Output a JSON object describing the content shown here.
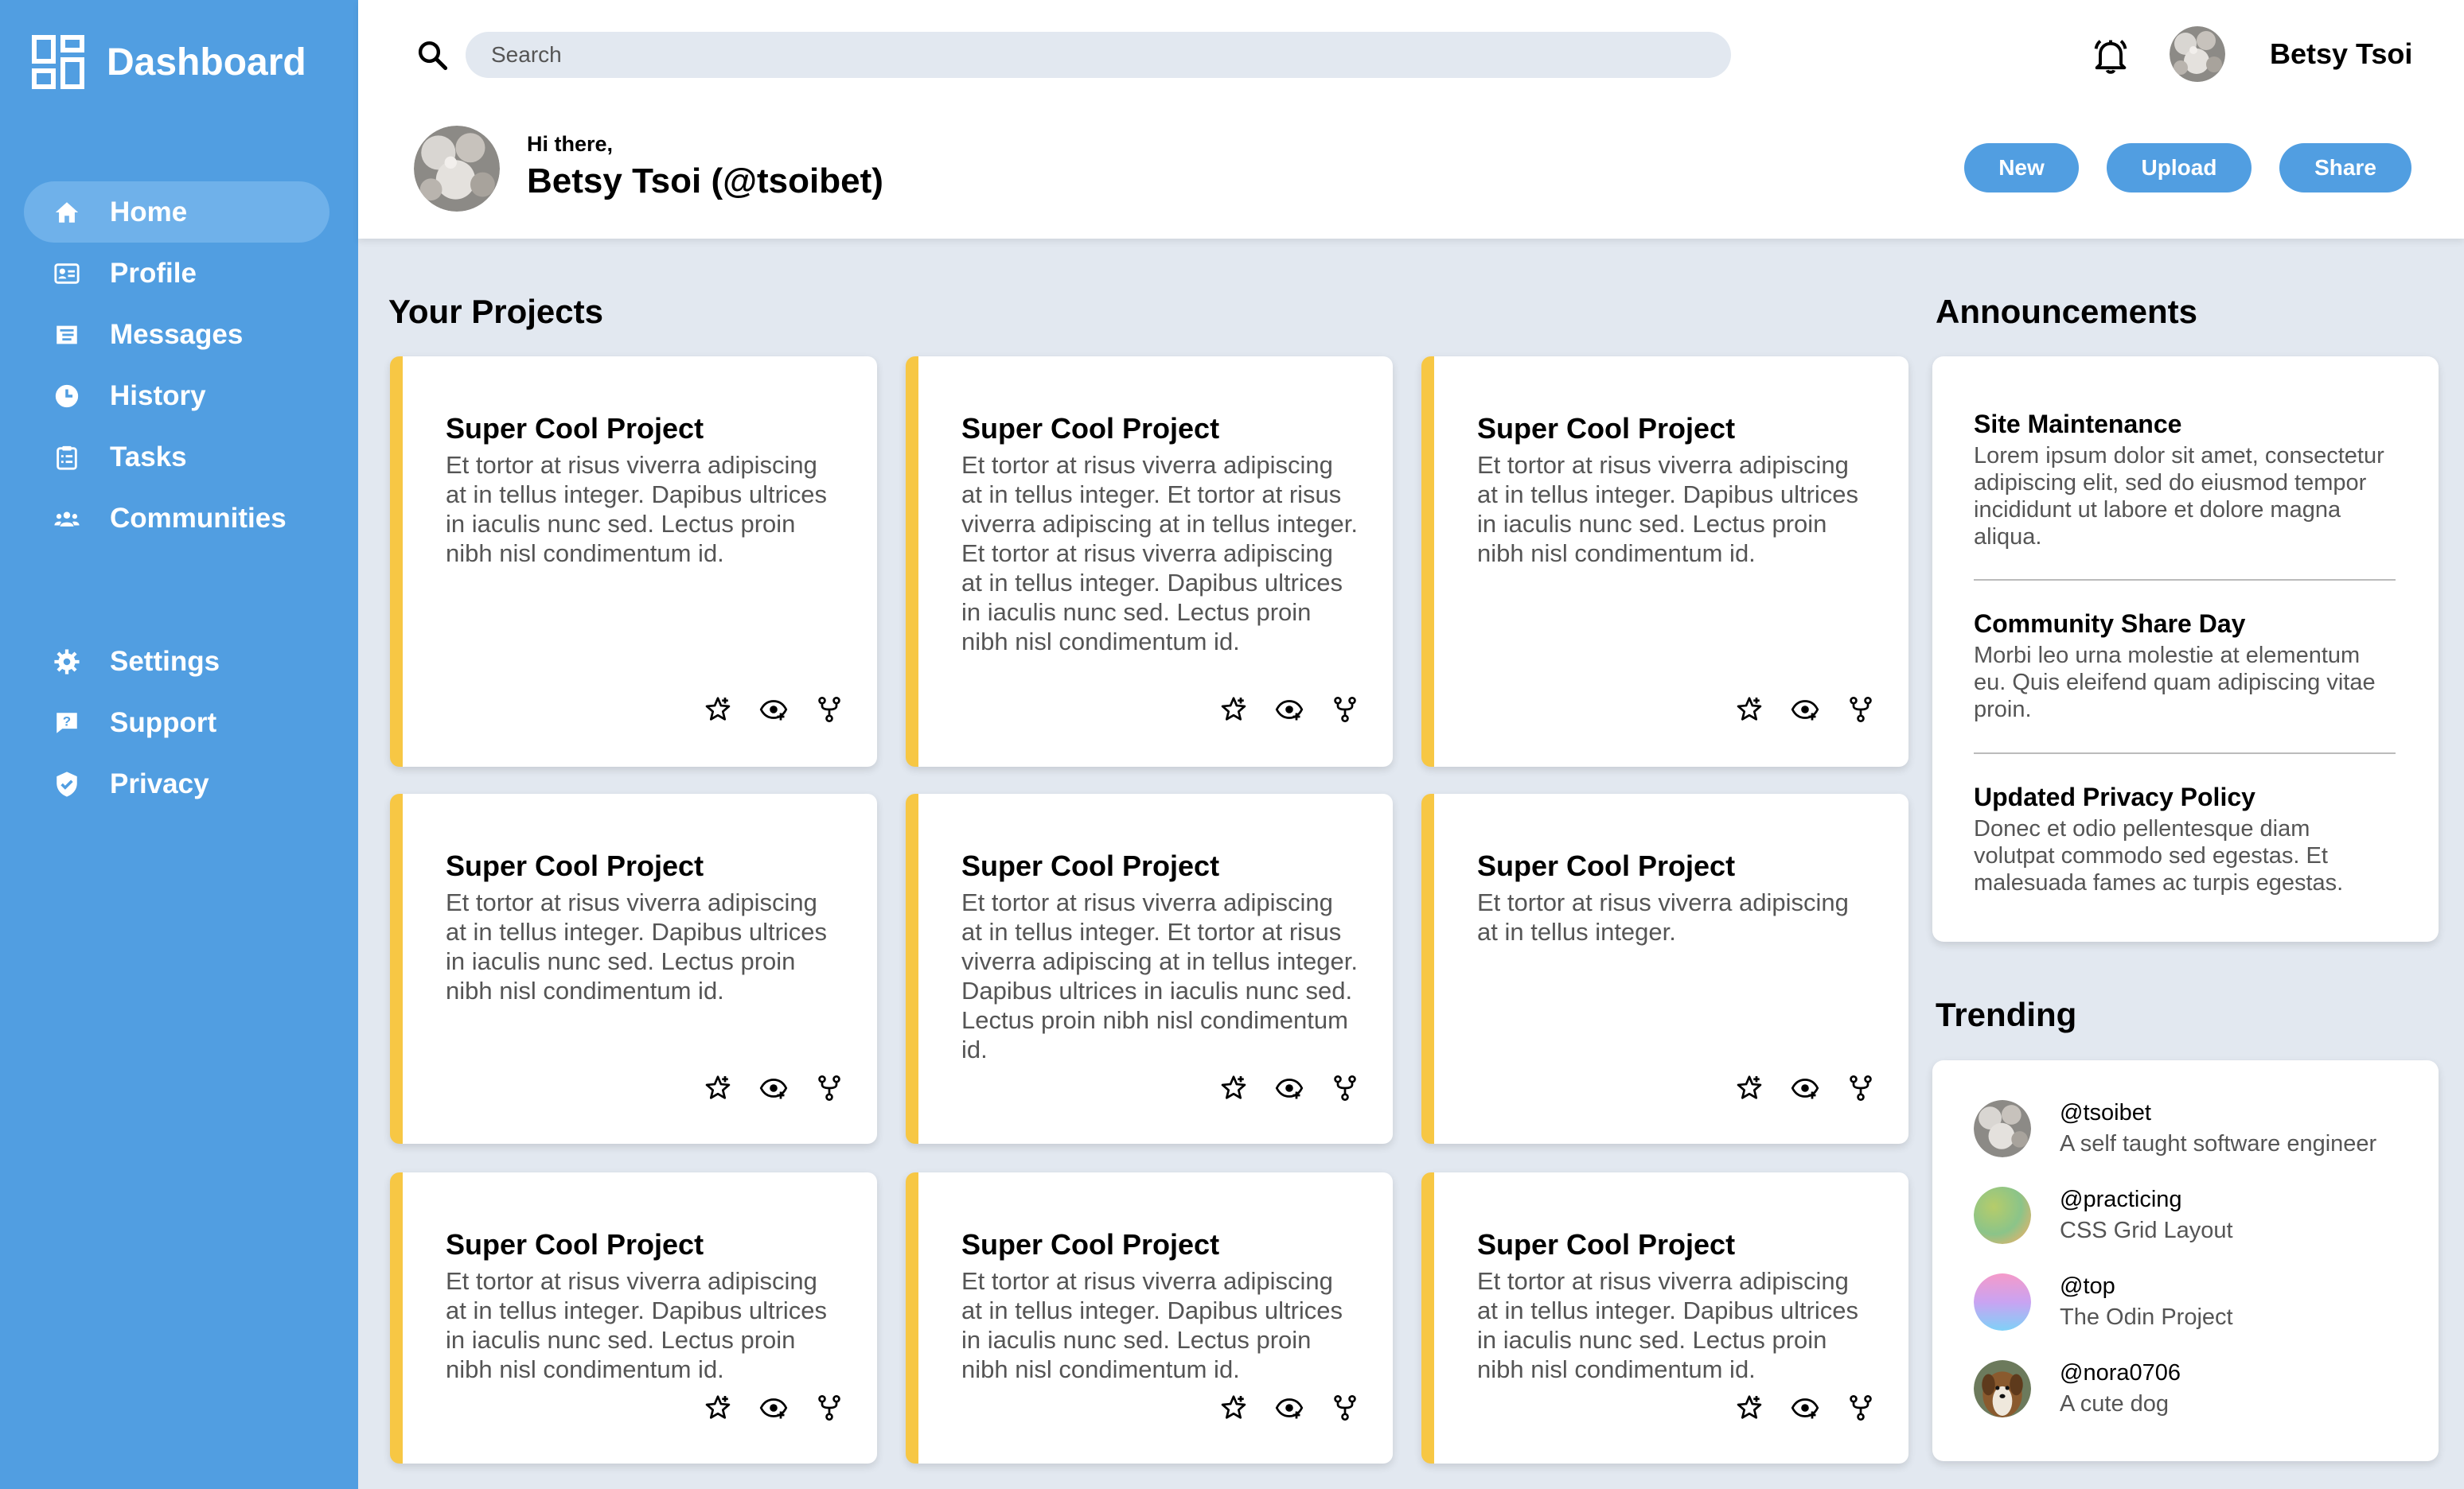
{
  "app": {
    "title": "Dashboard"
  },
  "sidebar": {
    "primary_items": [
      {
        "label": "Home",
        "icon": "home-icon",
        "active": true
      },
      {
        "label": "Profile",
        "icon": "id-card-icon"
      },
      {
        "label": "Messages",
        "icon": "messages-icon"
      },
      {
        "label": "History",
        "icon": "clock-icon"
      },
      {
        "label": "Tasks",
        "icon": "clipboard-icon"
      },
      {
        "label": "Communities",
        "icon": "people-icon"
      }
    ],
    "secondary_items": [
      {
        "label": "Settings",
        "icon": "gear-icon"
      },
      {
        "label": "Support",
        "icon": "help-chat-icon"
      },
      {
        "label": "Privacy",
        "icon": "shield-check-icon"
      }
    ]
  },
  "header": {
    "search_placeholder": "Search",
    "user_name": "Betsy Tsoi",
    "greeting": "Hi there,",
    "full_name": "Betsy Tsoi (@tsoibet)",
    "buttons": {
      "new": "New",
      "upload": "Upload",
      "share": "Share"
    }
  },
  "projects": {
    "title": "Your Projects",
    "cards": [
      {
        "title": "Super Cool Project",
        "description": "Et tortor at risus viverra adipiscing at in tellus integer. Dapibus ultrices in iaculis nunc sed. Lectus proin nibh nisl condimentum id."
      },
      {
        "title": "Super Cool Project",
        "description": "Et tortor at risus viverra adipiscing at in tellus integer. Et tortor at risus viverra adipiscing at in tellus integer. Et tortor at risus viverra adipiscing at in tellus integer. Dapibus ultrices in iaculis nunc sed. Lectus proin nibh nisl condimentum id."
      },
      {
        "title": "Super Cool Project",
        "description": "Et tortor at risus viverra adipiscing at in tellus integer. Dapibus ultrices in iaculis nunc sed. Lectus proin nibh nisl condimentum id."
      },
      {
        "title": "Super Cool Project",
        "description": "Et tortor at risus viverra adipiscing at in tellus integer. Dapibus ultrices in iaculis nunc sed. Lectus proin nibh nisl condimentum id."
      },
      {
        "title": "Super Cool Project",
        "description": "Et tortor at risus viverra adipiscing at in tellus integer. Et tortor at risus viverra adipiscing at in tellus integer. Dapibus ultrices in iaculis nunc sed. Lectus proin nibh nisl condimentum id."
      },
      {
        "title": "Super Cool Project",
        "description": "Et tortor at risus viverra adipiscing at in tellus integer."
      },
      {
        "title": "Super Cool Project",
        "description": "Et tortor at risus viverra adipiscing at in tellus integer. Dapibus ultrices in iaculis nunc sed. Lectus proin nibh nisl condimentum id."
      },
      {
        "title": "Super Cool Project",
        "description": "Et tortor at risus viverra adipiscing at in tellus integer. Dapibus ultrices in iaculis nunc sed. Lectus proin nibh nisl condimentum id."
      },
      {
        "title": "Super Cool Project",
        "description": "Et tortor at risus viverra adipiscing at in tellus integer. Dapibus ultrices in iaculis nunc sed. Lectus proin nibh nisl condimentum id."
      }
    ],
    "action_icons": [
      "star-icon",
      "watch-eye-icon",
      "fork-icon"
    ]
  },
  "announcements": {
    "title": "Announcements",
    "items": [
      {
        "title": "Site Maintenance",
        "text": "Lorem ipsum dolor sit amet, consectetur adipiscing elit, sed do eiusmod tempor incididunt ut labore et dolore magna aliqua."
      },
      {
        "title": "Community Share Day",
        "text": "Morbi leo urna molestie at elementum eu. Quis eleifend quam adipiscing vitae proin."
      },
      {
        "title": "Updated Privacy Policy",
        "text": "Donec et odio pellentesque diam volutpat commodo sed egestas. Et malesuada fames ac turpis egestas."
      }
    ]
  },
  "trending": {
    "title": "Trending",
    "items": [
      {
        "handle": "@tsoibet",
        "desc": "A self taught software engineer"
      },
      {
        "handle": "@practicing",
        "desc": "CSS Grid Layout"
      },
      {
        "handle": "@top",
        "desc": "The Odin Project"
      },
      {
        "handle": "@nora0706",
        "desc": "A cute dog"
      }
    ]
  },
  "colors": {
    "sidebar": "#519ee1",
    "accent": "#f7c744",
    "background": "#e2e8f0"
  }
}
